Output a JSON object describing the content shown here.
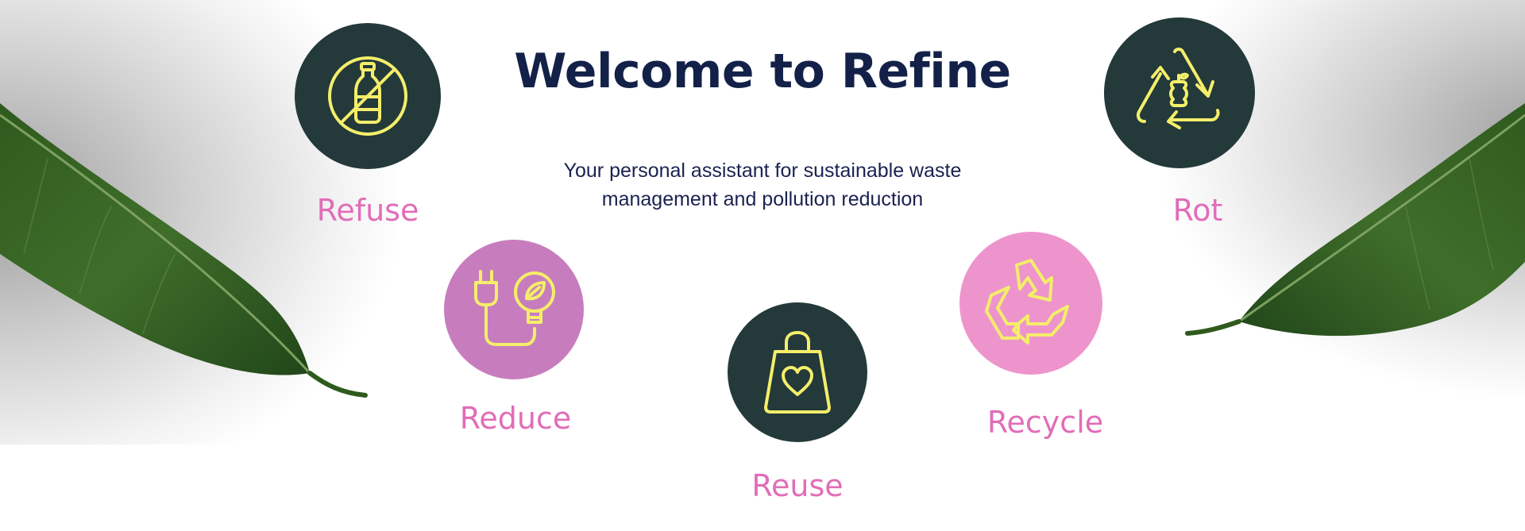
{
  "header": {
    "title": "Welcome to Refine",
    "subtitle": "Your personal assistant for sustainable waste management and pollution reduction"
  },
  "colors": {
    "dark_circle": "#23393a",
    "purple_circle": "#c77dbd",
    "pink_circle": "#ee94cc",
    "icon_stroke": "#f4ee6a",
    "label": "#e16db8",
    "title": "#132149"
  },
  "items": [
    {
      "label": "Refuse",
      "icon": "no-bottle-icon"
    },
    {
      "label": "Reduce",
      "icon": "plug-bulb-icon"
    },
    {
      "label": "Reuse",
      "icon": "shopping-bag-heart-icon"
    },
    {
      "label": "Recycle",
      "icon": "recycle-icon"
    },
    {
      "label": "Rot",
      "icon": "compost-cycle-icon"
    }
  ]
}
